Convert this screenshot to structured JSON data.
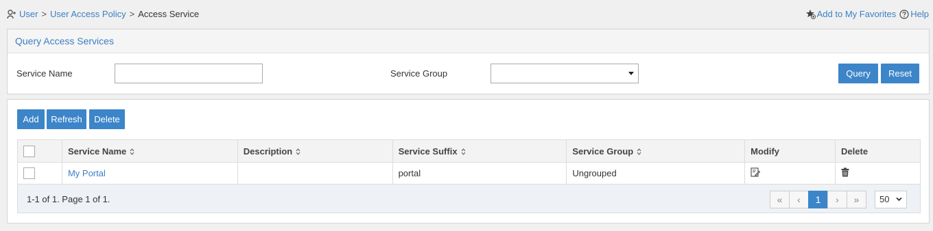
{
  "breadcrumb": {
    "items": [
      "User",
      "User Access Policy"
    ],
    "separator": ">",
    "current": "Access Service"
  },
  "toplinks": {
    "favorites": "Add to My Favorites",
    "help": "Help"
  },
  "query": {
    "title": "Query Access Services",
    "service_name_label": "Service Name",
    "service_name_value": "",
    "service_group_label": "Service Group",
    "service_group_value": "",
    "query_button": "Query",
    "reset_button": "Reset"
  },
  "toolbar": {
    "add": "Add",
    "refresh": "Refresh",
    "delete": "Delete"
  },
  "table": {
    "columns": {
      "service_name": "Service Name",
      "description": "Description",
      "service_suffix": "Service Suffix",
      "service_group": "Service Group",
      "modify": "Modify",
      "delete": "Delete"
    },
    "rows": [
      {
        "service_name": "My Portal",
        "description": "",
        "service_suffix": "portal",
        "service_group": "Ungrouped"
      }
    ]
  },
  "pager": {
    "info": "1-1 of 1. Page 1 of 1.",
    "first": "«",
    "prev": "‹",
    "current_page": "1",
    "next": "›",
    "last": "»",
    "page_size": "50"
  },
  "colors": {
    "accent": "#3c85c9",
    "link": "#3b7fc4"
  }
}
